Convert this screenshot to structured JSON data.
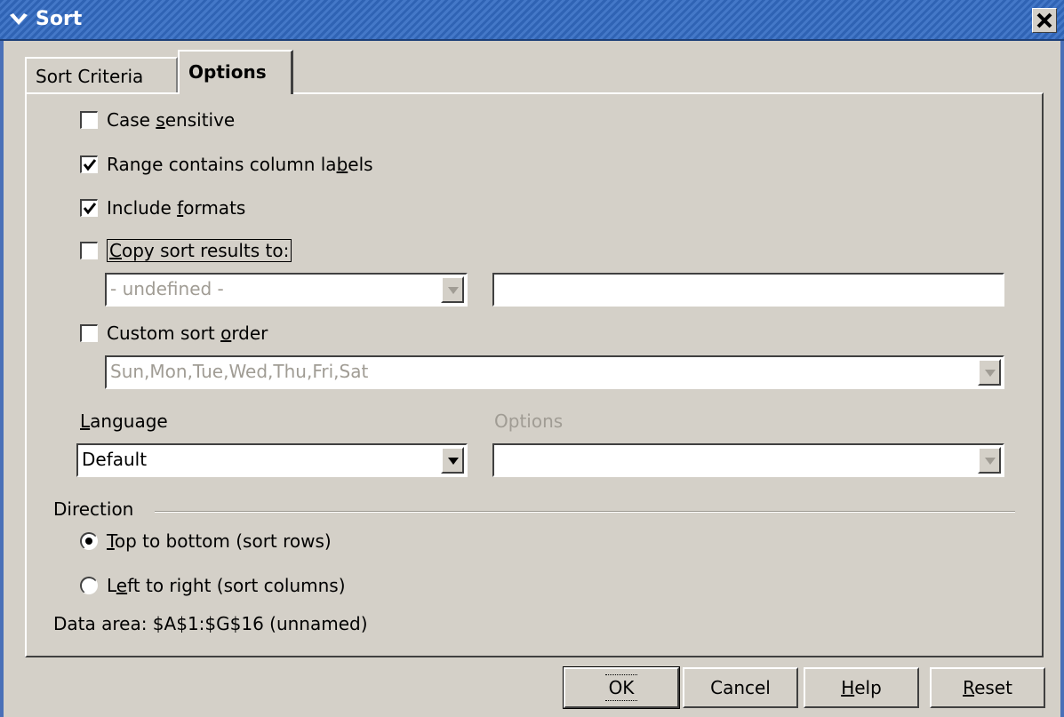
{
  "window": {
    "title": "Sort"
  },
  "tabs": [
    {
      "label": "Sort Criteria",
      "active": false
    },
    {
      "label": "Options",
      "active": true
    }
  ],
  "options": {
    "case_sensitive": {
      "pre": "Case ",
      "mnemonic": "s",
      "post": "ensitive",
      "checked": false
    },
    "range_labels": {
      "pre": "Range contains column la",
      "mnemonic": "b",
      "post": "els",
      "checked": true
    },
    "include_formats": {
      "pre": "Include ",
      "mnemonic": "f",
      "post": "ormats",
      "checked": true
    },
    "copy_results": {
      "pre": "",
      "mnemonic": "C",
      "post": "opy sort results to:",
      "checked": false
    },
    "copy_target_select": "- undefined -",
    "copy_target_input": "",
    "custom_order": {
      "pre": "Custom sort ",
      "mnemonic": "o",
      "post": "rder",
      "checked": false
    },
    "custom_order_select": "Sun,Mon,Tue,Wed,Thu,Fri,Sat",
    "language_label": {
      "pre": "",
      "mnemonic": "L",
      "post": "anguage"
    },
    "language_value": "Default",
    "options_label": "Options",
    "options_value": ""
  },
  "direction": {
    "label": "Direction",
    "top_bottom": {
      "pre": "",
      "mnemonic": "T",
      "post": "op to bottom (sort rows)",
      "selected": true
    },
    "left_right": {
      "pre": "L",
      "mnemonic": "e",
      "post": "ft to right (sort columns)",
      "selected": false
    }
  },
  "data_area": "Data area: $A$1:$G$16 (unnamed)",
  "buttons": {
    "ok": "OK",
    "cancel": "Cancel",
    "help": {
      "pre": "",
      "mnemonic": "H",
      "post": "elp"
    },
    "reset": {
      "pre": "",
      "mnemonic": "R",
      "post": "eset"
    }
  }
}
